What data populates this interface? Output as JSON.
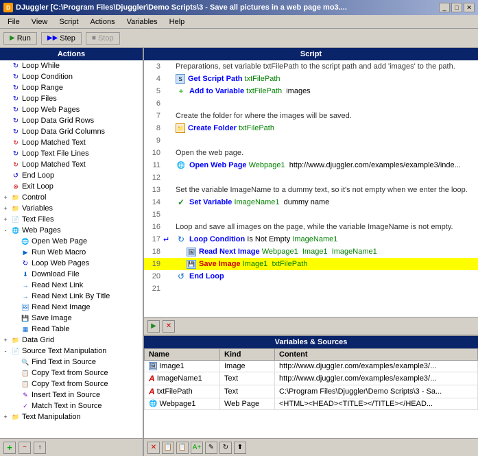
{
  "titleBar": {
    "title": "DJuggler [C:\\Program Files\\Djuggler\\Demo Scripts\\3 - Save all pictures in a web page  mo3....",
    "icon": "DJ"
  },
  "menuBar": {
    "items": [
      "File",
      "View",
      "Script",
      "Actions",
      "Variables",
      "Help"
    ]
  },
  "toolbar": {
    "runLabel": "Run",
    "stepLabel": "Step",
    "stopLabel": "Stop"
  },
  "leftPanel": {
    "header": "Actions",
    "treeItems": [
      {
        "id": "loop-while",
        "indent": 1,
        "label": "Loop While",
        "iconType": "loop",
        "expanded": false
      },
      {
        "id": "loop-condition",
        "indent": 1,
        "label": "Loop Condition",
        "iconType": "loop"
      },
      {
        "id": "loop-range",
        "indent": 1,
        "label": "Loop Range",
        "iconType": "loop"
      },
      {
        "id": "loop-files",
        "indent": 1,
        "label": "Loop Files",
        "iconType": "loop"
      },
      {
        "id": "loop-web-pages",
        "indent": 1,
        "label": "Loop Web Pages",
        "iconType": "loop"
      },
      {
        "id": "loop-data-grid-rows",
        "indent": 1,
        "label": "Loop Data Grid Rows",
        "iconType": "loop"
      },
      {
        "id": "loop-data-grid-cols",
        "indent": 1,
        "label": "Loop Data Grid Columns",
        "iconType": "loop"
      },
      {
        "id": "loop-matched-text",
        "indent": 1,
        "label": "Loop Matched Text",
        "iconType": "loop"
      },
      {
        "id": "loop-text-file-lines",
        "indent": 1,
        "label": "Loop Text File Lines",
        "iconType": "loop"
      },
      {
        "id": "loop-matched-text2",
        "indent": 1,
        "label": "Loop Matched Text",
        "iconType": "loop"
      },
      {
        "id": "end-loop",
        "indent": 1,
        "label": "End Loop",
        "iconType": "loop-end"
      },
      {
        "id": "exit-loop",
        "indent": 1,
        "label": "Exit Loop",
        "iconType": "loop-exit"
      },
      {
        "id": "control",
        "indent": 0,
        "label": "Control",
        "iconType": "folder",
        "expandable": true
      },
      {
        "id": "variables",
        "indent": 0,
        "label": "Variables",
        "iconType": "folder-orange",
        "expandable": true
      },
      {
        "id": "text-files",
        "indent": 0,
        "label": "Text Files",
        "iconType": "folder",
        "expandable": true
      },
      {
        "id": "web-pages",
        "indent": 0,
        "label": "Web Pages",
        "iconType": "folder-web",
        "expandable": true,
        "expanded": true
      },
      {
        "id": "open-web-page",
        "indent": 1,
        "label": "Open Web Page",
        "iconType": "web"
      },
      {
        "id": "run-web-macro",
        "indent": 1,
        "label": "Run Web Macro",
        "iconType": "web"
      },
      {
        "id": "loop-web-pages2",
        "indent": 1,
        "label": "Loop Web Pages",
        "iconType": "loop"
      },
      {
        "id": "download-file",
        "indent": 1,
        "label": "Download File",
        "iconType": "download"
      },
      {
        "id": "read-next-link",
        "indent": 1,
        "label": "Read Next Link",
        "iconType": "read"
      },
      {
        "id": "read-next-link-by-title",
        "indent": 1,
        "label": "Read Next Link By Title",
        "iconType": "read"
      },
      {
        "id": "read-next-image",
        "indent": 1,
        "label": "Read Next Image",
        "iconType": "image"
      },
      {
        "id": "save-image",
        "indent": 1,
        "label": "Save Image",
        "iconType": "image-save"
      },
      {
        "id": "read-table",
        "indent": 1,
        "label": "Read Table",
        "iconType": "table"
      },
      {
        "id": "data-grid",
        "indent": 0,
        "label": "Data Grid",
        "iconType": "folder",
        "expandable": true
      },
      {
        "id": "source-text-manip",
        "indent": 0,
        "label": "Source Text Manipulation",
        "iconType": "source",
        "expandable": true,
        "expanded": true
      },
      {
        "id": "find-text-in-source",
        "indent": 1,
        "label": "Find Text in Source",
        "iconType": "find"
      },
      {
        "id": "copy-text-from-source",
        "indent": 1,
        "label": "Copy Text from Source",
        "iconType": "copy"
      },
      {
        "id": "copy-text-from-source2",
        "indent": 1,
        "label": "Copy Text from Source",
        "iconType": "copy"
      },
      {
        "id": "insert-text-in-source",
        "indent": 1,
        "label": "Insert Text in Source",
        "iconType": "insert"
      },
      {
        "id": "match-text-in-source",
        "indent": 1,
        "label": "Match Text in Source",
        "iconType": "match"
      },
      {
        "id": "text-manipulation",
        "indent": 0,
        "label": "Text Manipulation",
        "iconType": "folder",
        "expandable": true
      }
    ]
  },
  "scriptPanel": {
    "header": "Script",
    "rows": [
      {
        "lineNum": "3",
        "type": "comment",
        "text": "Preparations, set variable txtFilePath to the script path and add 'images' to the path.",
        "arrow": false
      },
      {
        "lineNum": "4",
        "type": "action",
        "iconType": "script-path",
        "keyword": "Get Script Path",
        "params": "txtFilePath",
        "arrow": false
      },
      {
        "lineNum": "5",
        "type": "action",
        "iconType": "add-var",
        "keyword": "Add to Variable",
        "params": "txtFilePath  images",
        "arrow": false
      },
      {
        "lineNum": "6",
        "type": "blank",
        "text": "",
        "arrow": false
      },
      {
        "lineNum": "7",
        "type": "comment",
        "text": "Create the folder for where the images will be saved.",
        "arrow": false
      },
      {
        "lineNum": "8",
        "type": "action",
        "iconType": "folder-create",
        "keyword": "Create Folder",
        "params": "txtFilePath",
        "arrow": false
      },
      {
        "lineNum": "9",
        "type": "blank",
        "text": "",
        "arrow": false
      },
      {
        "lineNum": "10",
        "type": "comment",
        "text": "Open the web page.",
        "arrow": false
      },
      {
        "lineNum": "11",
        "type": "action",
        "iconType": "web-open",
        "keyword": "Open Web Page",
        "params": "Webpage1  http://www.djuggler.com/examples/example3/inde...",
        "arrow": false
      },
      {
        "lineNum": "12",
        "type": "blank",
        "text": "",
        "arrow": false
      },
      {
        "lineNum": "13",
        "type": "comment",
        "text": "Set the variable ImageName to a dummy text, so it's not empty when we enter the loop.",
        "arrow": false
      },
      {
        "lineNum": "14",
        "type": "action",
        "iconType": "set-var",
        "keyword": "Set Variable",
        "params": "ImageName1  dummy name",
        "arrow": false
      },
      {
        "lineNum": "15",
        "type": "blank",
        "text": "",
        "arrow": false
      },
      {
        "lineNum": "16",
        "type": "comment",
        "text": "Loop and save all images on the page, while the variable ImageName is not empty.",
        "arrow": false
      },
      {
        "lineNum": "17",
        "type": "action",
        "iconType": "loop-cond",
        "keyword": "Loop Condition",
        "params": "Is Not Empty  ImageName1",
        "arrow": true
      },
      {
        "lineNum": "18",
        "type": "action",
        "iconType": "read-img",
        "keyword": "Read Next Image",
        "params": "Webpage1  Image1  ImageName1",
        "arrow": false
      },
      {
        "lineNum": "19",
        "type": "action",
        "iconType": "save-img",
        "keyword": "Save Image",
        "params": "Image1  txtFilePath",
        "arrow": false,
        "highlighted": true
      },
      {
        "lineNum": "20",
        "type": "action",
        "iconType": "end-loop",
        "keyword": "End Loop",
        "params": "",
        "arrow": false
      },
      {
        "lineNum": "21",
        "type": "blank",
        "text": "",
        "arrow": false
      }
    ]
  },
  "variablesPanel": {
    "header": "Variables & Sources",
    "columns": [
      "Name",
      "Kind",
      "Content"
    ],
    "rows": [
      {
        "name": "Image1",
        "nameIcon": "image-icon",
        "kind": "Image",
        "content": "http://www.djuggler.com/examples/example3/..."
      },
      {
        "name": "ImageName1",
        "nameIcon": "text-icon",
        "kind": "Text",
        "content": "http://www.djuggler.com/examples/example3/..."
      },
      {
        "name": "txtFilePath",
        "nameIcon": "text-icon",
        "kind": "Text",
        "content": "C:\\Program Files\\Djuggler\\Demo Scripts\\3 - Sa..."
      },
      {
        "name": "Webpage1",
        "nameIcon": "web-icon",
        "kind": "Web Page",
        "content": "<HTML><HEAD><TITLE></TITLE></HEAD..."
      }
    ]
  }
}
